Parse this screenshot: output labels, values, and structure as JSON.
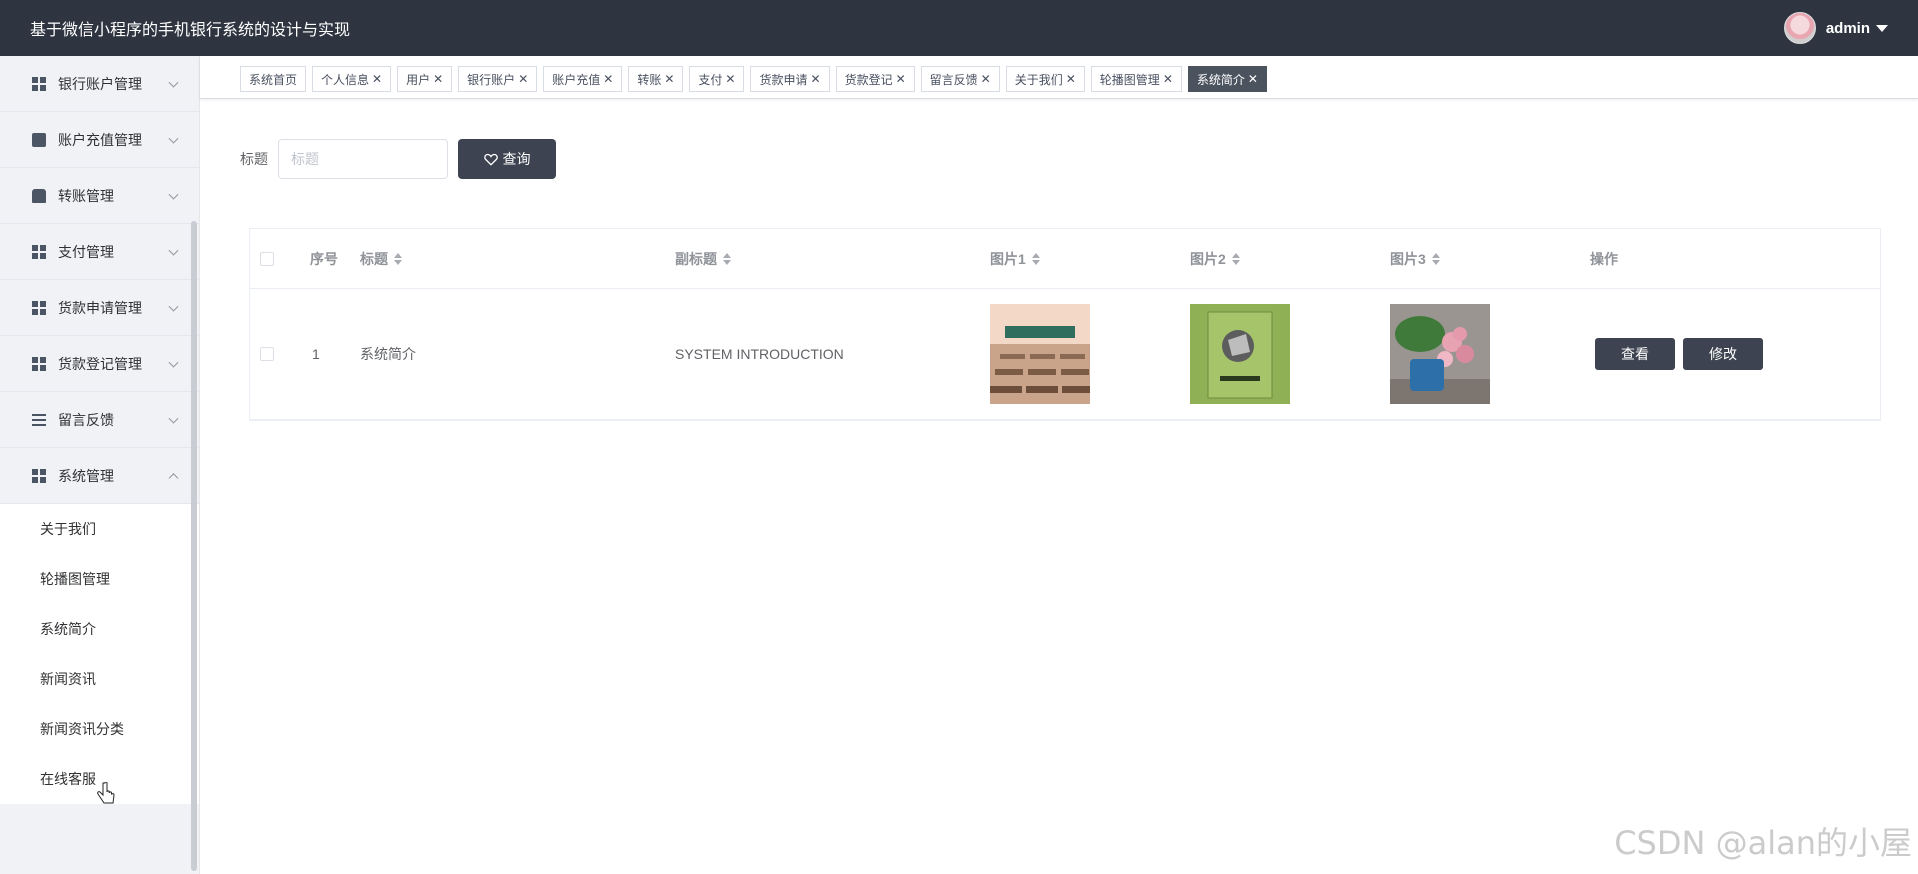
{
  "header": {
    "title": "基于微信小程序的手机银行系统的设计与实现",
    "username": "admin"
  },
  "sidebar": {
    "items": [
      {
        "label": "银行账户管理",
        "icon": "grid-icon"
      },
      {
        "label": "账户充值管理",
        "icon": "clipboard-check-icon"
      },
      {
        "label": "转账管理",
        "icon": "bus-icon"
      },
      {
        "label": "支付管理",
        "icon": "grid-icon"
      },
      {
        "label": "货款申请管理",
        "icon": "grid-icon"
      },
      {
        "label": "货款登记管理",
        "icon": "grid-icon"
      },
      {
        "label": "留言反馈",
        "icon": "list-icon"
      },
      {
        "label": "系统管理",
        "icon": "grid-icon",
        "expanded": true
      }
    ],
    "submenu": [
      {
        "label": "关于我们"
      },
      {
        "label": "轮播图管理"
      },
      {
        "label": "系统简介"
      },
      {
        "label": "新闻资讯"
      },
      {
        "label": "新闻资讯分类"
      },
      {
        "label": "在线客服"
      }
    ]
  },
  "tabs": [
    {
      "label": "系统首页",
      "closable": false
    },
    {
      "label": "个人信息",
      "closable": true
    },
    {
      "label": "用户",
      "closable": true
    },
    {
      "label": "银行账户",
      "closable": true
    },
    {
      "label": "账户充值",
      "closable": true
    },
    {
      "label": "转账",
      "closable": true
    },
    {
      "label": "支付",
      "closable": true
    },
    {
      "label": "货款申请",
      "closable": true
    },
    {
      "label": "货款登记",
      "closable": true
    },
    {
      "label": "留言反馈",
      "closable": true
    },
    {
      "label": "关于我们",
      "closable": true
    },
    {
      "label": "轮播图管理",
      "closable": true
    },
    {
      "label": "系统简介",
      "closable": true,
      "active": true
    }
  ],
  "search": {
    "label": "标题",
    "placeholder": "标题",
    "button_label": "查询"
  },
  "table": {
    "headers": {
      "index": "序号",
      "title": "标题",
      "subtitle": "副标题",
      "pic1": "图片1",
      "pic2": "图片2",
      "pic3": "图片3",
      "actions": "操作"
    },
    "rows": [
      {
        "index": "1",
        "title": "系统简介",
        "subtitle": "SYSTEM INTRODUCTION",
        "view_label": "查看",
        "edit_label": "修改"
      }
    ]
  },
  "watermark": "CSDN @alan的小屋",
  "colors": {
    "topbar": "#2e3440",
    "accent_button": "#3d4350",
    "active_tab": "#4b535f"
  }
}
